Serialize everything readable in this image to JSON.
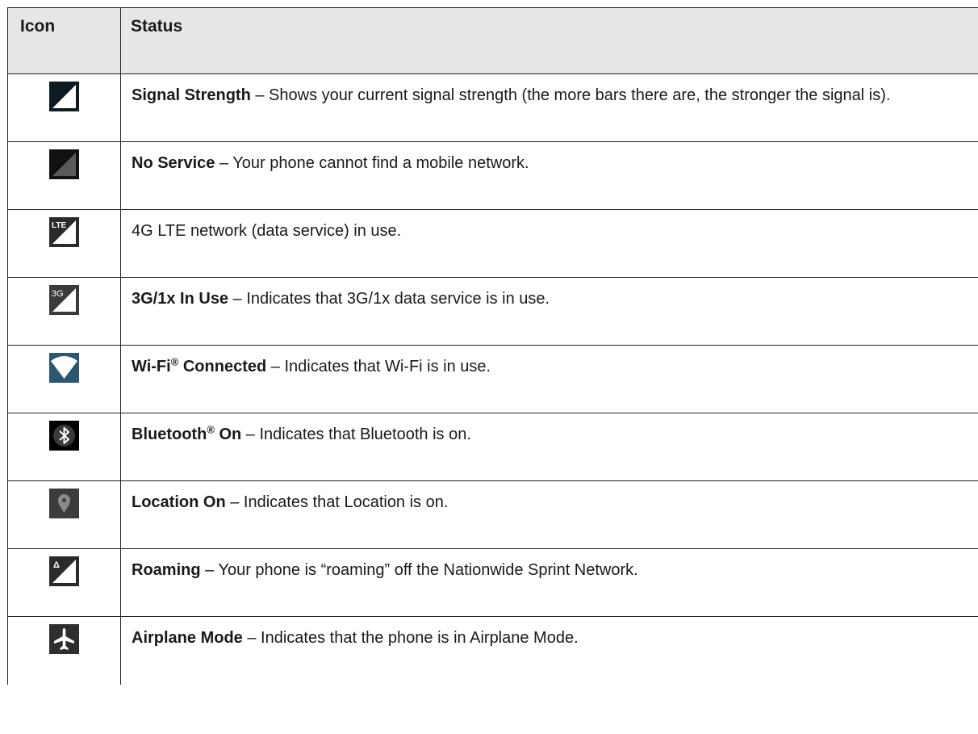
{
  "table": {
    "headers": {
      "icon": "Icon",
      "status": "Status"
    },
    "rows": [
      {
        "icon": "signal-strength-icon",
        "title": "Signal Strength",
        "sep": " – ",
        "desc": "Shows your current signal strength (the more bars there are, the stronger the signal is)."
      },
      {
        "icon": "no-service-icon",
        "title": "No Service",
        "sep": " – ",
        "desc": "Your phone cannot find a mobile network."
      },
      {
        "icon": "lte-icon",
        "icon_label": "LTE",
        "title": "",
        "sep": "",
        "desc": "4G LTE network (data service) in use."
      },
      {
        "icon": "3g-icon",
        "icon_label": "3G",
        "title": "3G/1x In Use",
        "sep": " – ",
        "desc": "Indicates that 3G/1x data service is in use."
      },
      {
        "icon": "wifi-icon",
        "title": "Wi-Fi",
        "reg": "®",
        "title_after": " Connected",
        "sep": " – ",
        "desc": "Indicates that Wi-Fi is in use."
      },
      {
        "icon": "bluetooth-icon",
        "title": "Bluetooth",
        "reg": "®",
        "title_after": " On",
        "sep": " – ",
        "desc": "Indicates that Bluetooth is on."
      },
      {
        "icon": "location-icon",
        "title": "Location On",
        "sep": " – ",
        "desc": "Indicates that Location is on."
      },
      {
        "icon": "roaming-icon",
        "icon_label": "Δ",
        "title": "Roaming",
        "sep": " – ",
        "desc": "Your phone is “roaming” off the Nationwide Sprint Network."
      },
      {
        "icon": "airplane-icon",
        "title": "Airplane Mode",
        "sep": " – ",
        "desc": "Indicates that the phone is in Airplane Mode."
      }
    ]
  },
  "colors": {
    "header_bg": "#e6e6e6",
    "icon_dark": "#1f1f1f",
    "wifi_bg": "#3b6d8c"
  }
}
